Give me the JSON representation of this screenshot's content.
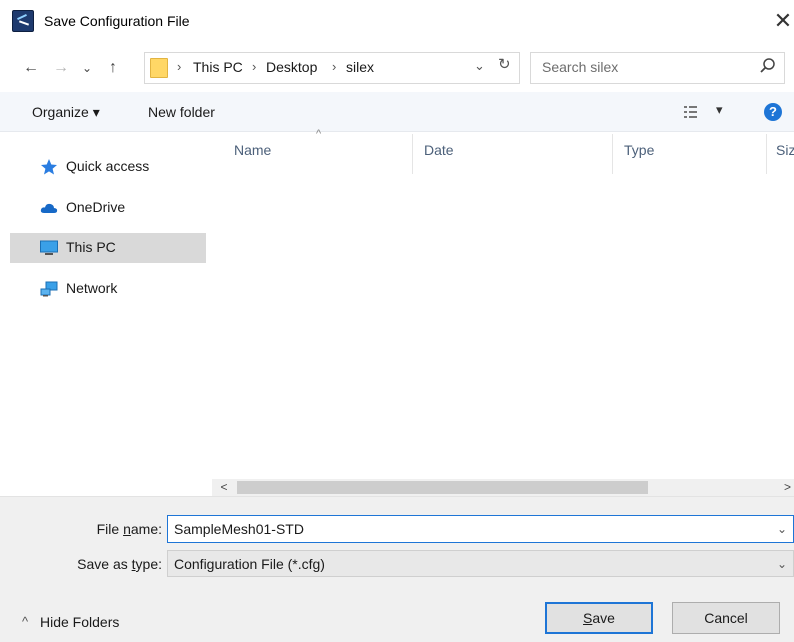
{
  "window": {
    "title": "Save Configuration File",
    "close_glyph": "✕"
  },
  "nav": {
    "back": "←",
    "forward": "→",
    "recent": "⌄",
    "up": "↑",
    "breadcrumb": [
      "This PC",
      "Desktop",
      "silex"
    ],
    "separator": "›",
    "address_dropdown": "⌄",
    "refresh": "↻",
    "search_placeholder": "Search silex"
  },
  "toolbar": {
    "organize": "Organize ▾",
    "new_folder": "New folder",
    "view_dropdown": "▾",
    "help": "?"
  },
  "sidebar": {
    "items": [
      {
        "label": "Quick access",
        "icon": "star-icon",
        "selected": false
      },
      {
        "label": "OneDrive",
        "icon": "cloud-icon",
        "selected": false
      },
      {
        "label": "This PC",
        "icon": "monitor-icon",
        "selected": true
      },
      {
        "label": "Network",
        "icon": "network-icon",
        "selected": false
      }
    ]
  },
  "file_list": {
    "columns": [
      "Name",
      "Date",
      "Type",
      "Siz"
    ],
    "sort_indicator": "^",
    "rows": []
  },
  "scroll": {
    "left_arrow": "<",
    "right_arrow": ">"
  },
  "form": {
    "file_name_label_pre": "File ",
    "file_name_label_ul": "n",
    "file_name_label_post": "ame:",
    "file_name_value": "SampleMesh01-STD",
    "save_type_label_pre": "Save as ",
    "save_type_label_ul": "t",
    "save_type_label_post": "ype:",
    "save_type_value": "Configuration File (*.cfg)",
    "chevron": "⌄"
  },
  "footer": {
    "hide_folders": "Hide Folders",
    "hide_caret": "^",
    "save_ul": "S",
    "save_rest": "ave",
    "cancel": "Cancel"
  },
  "colors": {
    "accent": "#1e75d6",
    "selection": "#d9d9d9",
    "toolbar_bg": "#f4f7fb",
    "bottom_bg": "#f0f0f0"
  }
}
